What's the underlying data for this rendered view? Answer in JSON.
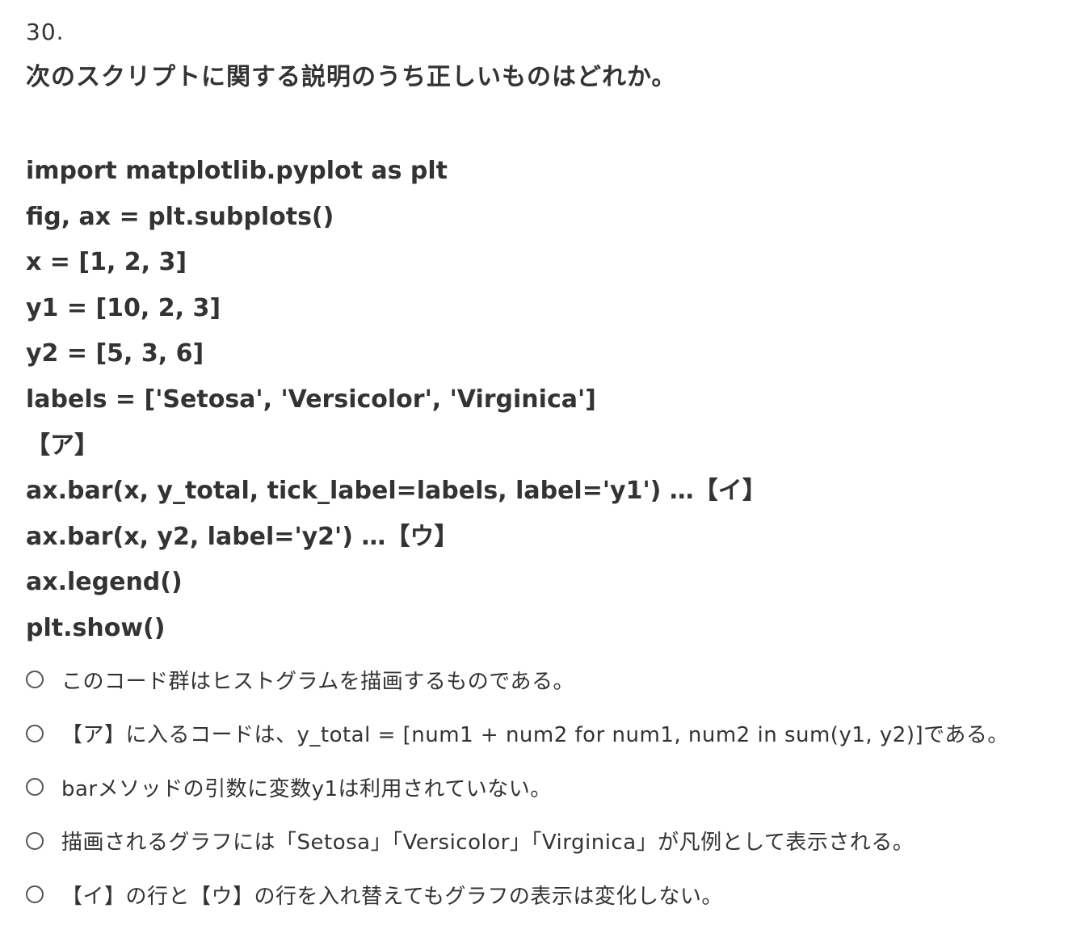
{
  "question": {
    "number": "30.",
    "title": "次のスクリプトに関する説明のうち正しいものはどれか。"
  },
  "code_lines": [
    "import matplotlib.pyplot as plt",
    "fig, ax = plt.subplots()",
    "x = [1, 2, 3]",
    "y1 = [10, 2, 3]",
    "y2 = [5, 3, 6]",
    "labels = ['Setosa', 'Versicolor', 'Virginica']",
    "【ア】",
    "ax.bar(x, y_total, tick_label=labels, label='y1') …【イ】",
    "ax.bar(x, y2, label='y2') …【ウ】",
    "ax.legend()",
    "plt.show()"
  ],
  "options": [
    "このコード群はヒストグラムを描画するものである。",
    "【ア】に入るコードは、y_total = [num1 + num2 for num1, num2 in sum(y1, y2)]である。",
    "barメソッドの引数に変数y1は利用されていない。",
    "描画されるグラフには「Setosa」「Versicolor」「Virginica」が凡例として表示される。",
    "【イ】の行と【ウ】の行を入れ替えてもグラフの表示は変化しない。"
  ]
}
